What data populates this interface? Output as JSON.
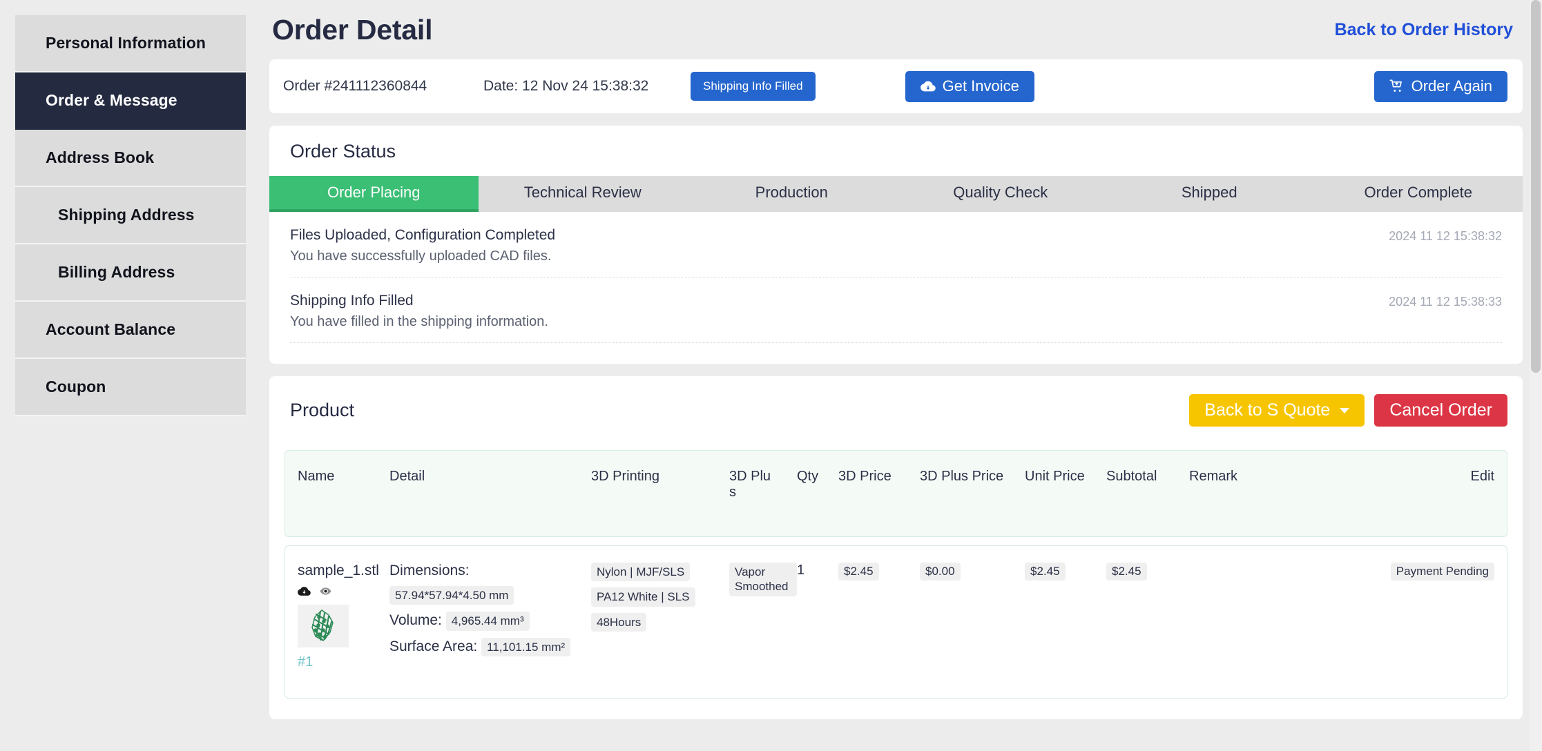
{
  "sidebar": {
    "items": [
      {
        "label": "Personal Information",
        "active": false,
        "sub": false
      },
      {
        "label": "Order & Message",
        "active": true,
        "sub": false
      },
      {
        "label": "Address Book",
        "active": false,
        "sub": false
      },
      {
        "label": "Shipping Address",
        "active": false,
        "sub": true
      },
      {
        "label": "Billing Address",
        "active": false,
        "sub": true
      },
      {
        "label": "Account Balance",
        "active": false,
        "sub": false
      },
      {
        "label": "Coupon",
        "active": false,
        "sub": false
      }
    ]
  },
  "header": {
    "title": "Order Detail",
    "back_link": "Back to Order History"
  },
  "order_bar": {
    "order_id": "Order #241112360844",
    "date": "Date: 12 Nov 24 15:38:32",
    "status_badge": "Shipping Info Filled",
    "get_invoice": "Get Invoice",
    "order_again": "Order Again",
    "invoice_icon": "cloud-download-icon",
    "order_again_icon": "cart-plus-icon"
  },
  "order_status": {
    "title": "Order Status",
    "steps": [
      {
        "label": "Order Placing",
        "active": true
      },
      {
        "label": "Technical Review",
        "active": false
      },
      {
        "label": "Production",
        "active": false
      },
      {
        "label": "Quality Check",
        "active": false
      },
      {
        "label": "Shipped",
        "active": false
      },
      {
        "label": "Order Complete",
        "active": false
      }
    ],
    "logs": [
      {
        "title": "Files Uploaded, Configuration Completed",
        "desc": "You have successfully uploaded CAD files.",
        "time": "2024 11 12 15:38:32"
      },
      {
        "title": "Shipping Info Filled",
        "desc": "You have filled in the shipping information.",
        "time": "2024 11 12 15:38:33"
      }
    ]
  },
  "product": {
    "title": "Product",
    "back_quote_label": "Back to S Quote",
    "cancel_label": "Cancel Order",
    "columns": {
      "name": "Name",
      "detail": "Detail",
      "printing": "3D Printing",
      "plus": "3D Plu\ns",
      "qty": "Qty",
      "price": "3D Price",
      "plus_price": "3D Plus Price",
      "unit_price": "Unit Price",
      "subtotal": "Subtotal",
      "remark": "Remark",
      "edit": "Edit"
    },
    "row": {
      "file_name": "sample_1.stl",
      "download_icon": "cloud-download-icon",
      "preview_icon": "eye-icon",
      "index_tag": "#1",
      "dimensions_label": "Dimensions:",
      "dimensions_value": "57.94*57.94*4.50 mm",
      "volume_label": "Volume:",
      "volume_value": "4,965.44 mm³",
      "surface_label": "Surface Area:",
      "surface_value": "11,101.15 mm²",
      "printing_tags": [
        "Nylon | MJF/SLS",
        "PA12 White | SLS",
        "48Hours"
      ],
      "plus_tag": "Vapor Smoothed",
      "qty": "1",
      "price_3d": "$2.45",
      "price_3d_plus": "$0.00",
      "unit_price": "$2.45",
      "subtotal": "$2.45",
      "remark": "",
      "edit": "Payment Pending"
    }
  },
  "colors": {
    "accent_blue": "#2566ce",
    "link_blue": "#1f4ed8",
    "active_green": "#3bbf75",
    "warning_yellow": "#f7c500",
    "danger_red": "#dc3545",
    "sidebar_active": "#242a40",
    "header_bg": "#f4fbf7"
  }
}
